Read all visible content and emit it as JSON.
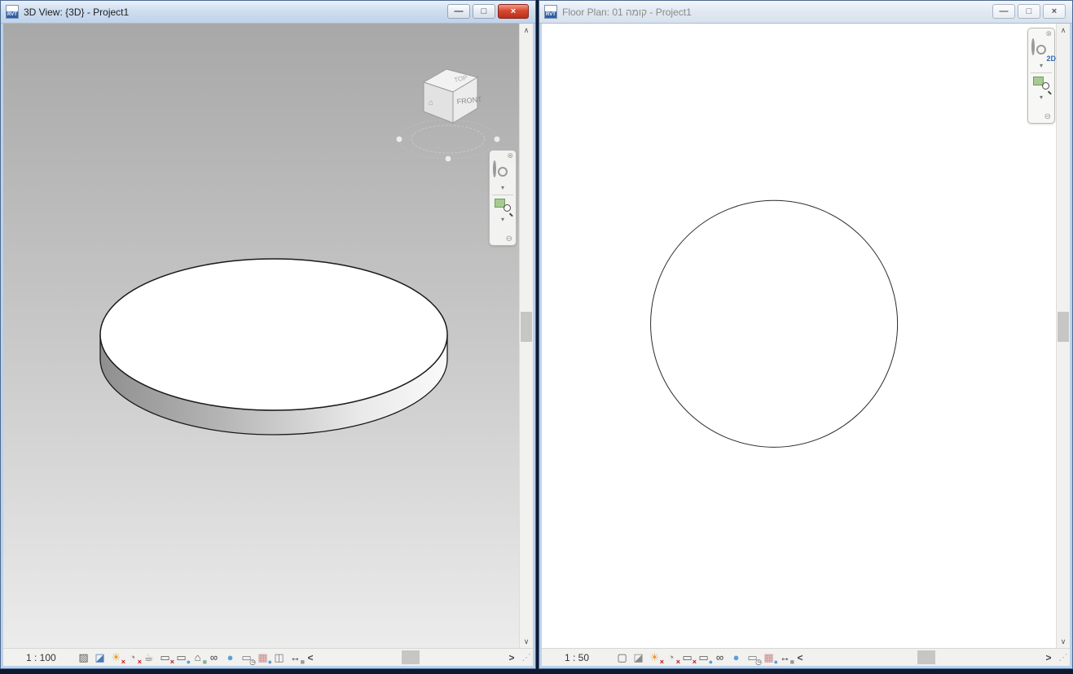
{
  "left_window": {
    "title": "3D View: {3D} - Project1",
    "file_icon_label": "RVT",
    "controls": {
      "minimize": "—",
      "maximize": "□",
      "close": "×"
    },
    "viewcube": {
      "top_label": "TOP",
      "front_label": "FRONT",
      "home_glyph": "⌂"
    },
    "navigation_bar": {
      "close_glyph": "⊗",
      "dropdown_glyph": "▾",
      "collapse_glyph": "⊖",
      "icons": [
        "steering-wheel",
        "zoom-region"
      ]
    },
    "view_control_bar": {
      "scale": "1 : 100",
      "icons": [
        {
          "name": "detail-level-icon",
          "glyph": "▨",
          "color": "#5a5a5a"
        },
        {
          "name": "visual-style-icon",
          "glyph": "◪",
          "color": "#4a7ab8"
        },
        {
          "name": "sun-path-icon",
          "glyph": "☀",
          "color": "#e79a2e",
          "badge": "×",
          "badge_color": "#cc1414"
        },
        {
          "name": "shadows-icon",
          "glyph": "◔",
          "color": "#8a8a8a",
          "badge": "×",
          "badge_color": "#cc1414"
        },
        {
          "name": "rendering-dialog-icon",
          "glyph": "☕",
          "color": "#7d746a"
        },
        {
          "name": "crop-view-icon",
          "glyph": "▭",
          "color": "#555555",
          "badge": "×",
          "badge_color": "#cc1414"
        },
        {
          "name": "show-crop-region-icon",
          "glyph": "▭",
          "color": "#555555",
          "badge": "●",
          "badge_color": "#5a9fd6"
        },
        {
          "name": "locked-3d-view-icon",
          "glyph": "⌂",
          "color": "#555555",
          "badge": "■",
          "badge_color": "#8ab3a0"
        },
        {
          "name": "temporary-hide-isolate-icon",
          "glyph": "∞",
          "color": "#3a3a3a"
        },
        {
          "name": "reveal-hidden-elements-icon",
          "glyph": "●",
          "color": "#5a9fd6"
        },
        {
          "name": "temporary-view-properties-icon",
          "glyph": "▭",
          "color": "#777777",
          "badge": "◷",
          "badge_color": "#555555"
        },
        {
          "name": "analytical-model-icon",
          "glyph": "▦",
          "color": "#c98a8a",
          "badge": "●",
          "badge_color": "#5a9fd6"
        },
        {
          "name": "highlight-displacement-sets-icon",
          "glyph": "◫",
          "color": "#777777"
        },
        {
          "name": "reveal-constraints-icon",
          "glyph": "↔",
          "color": "#3a3a3a",
          "badge": "■",
          "badge_color": "#999999"
        }
      ]
    },
    "h_scroll": {
      "left_arrow": "<",
      "right_arrow": ">",
      "grip": "⋰"
    },
    "v_scroll": {
      "up_arrow": "∧",
      "down_arrow": "∨"
    }
  },
  "right_window": {
    "title": "Floor Plan: 01 קומה - Project1",
    "file_icon_label": "RVT",
    "controls": {
      "minimize": "—",
      "maximize": "□",
      "close": "×"
    },
    "navigation_bar": {
      "close_glyph": "⊗",
      "dropdown_glyph": "▾",
      "collapse_glyph": "⊖",
      "wheel_badge": "2D",
      "icons": [
        "steering-wheel-2d",
        "zoom-region"
      ]
    },
    "view_control_bar": {
      "scale": "1 : 50",
      "icons": [
        {
          "name": "detail-level-icon",
          "glyph": "▢",
          "color": "#5a5a5a"
        },
        {
          "name": "visual-style-icon",
          "glyph": "◪",
          "color": "#8a8a8a"
        },
        {
          "name": "sun-path-icon",
          "glyph": "☀",
          "color": "#e79a2e",
          "badge": "×",
          "badge_color": "#cc1414"
        },
        {
          "name": "shadows-icon",
          "glyph": "◔",
          "color": "#8a8a8a",
          "badge": "×",
          "badge_color": "#cc1414"
        },
        {
          "name": "crop-view-icon",
          "glyph": "▭",
          "color": "#555555",
          "badge": "×",
          "badge_color": "#cc1414"
        },
        {
          "name": "show-crop-region-icon",
          "glyph": "▭",
          "color": "#555555",
          "badge": "●",
          "badge_color": "#5a9fd6"
        },
        {
          "name": "temporary-hide-isolate-icon",
          "glyph": "∞",
          "color": "#3a3a3a"
        },
        {
          "name": "reveal-hidden-elements-icon",
          "glyph": "●",
          "color": "#5a9fd6"
        },
        {
          "name": "temporary-view-properties-icon",
          "glyph": "▭",
          "color": "#777777",
          "badge": "◷",
          "badge_color": "#555555"
        },
        {
          "name": "analytical-model-icon",
          "glyph": "▦",
          "color": "#c98a8a",
          "badge": "●",
          "badge_color": "#5a9fd6"
        },
        {
          "name": "reveal-constraints-icon",
          "glyph": "↔",
          "color": "#3a3a3a",
          "badge": "■",
          "badge_color": "#999999"
        }
      ]
    },
    "h_scroll": {
      "left_arrow": "<",
      "right_arrow": ">",
      "grip": "⋰"
    },
    "v_scroll": {
      "up_arrow": "∧",
      "down_arrow": "∨"
    }
  }
}
